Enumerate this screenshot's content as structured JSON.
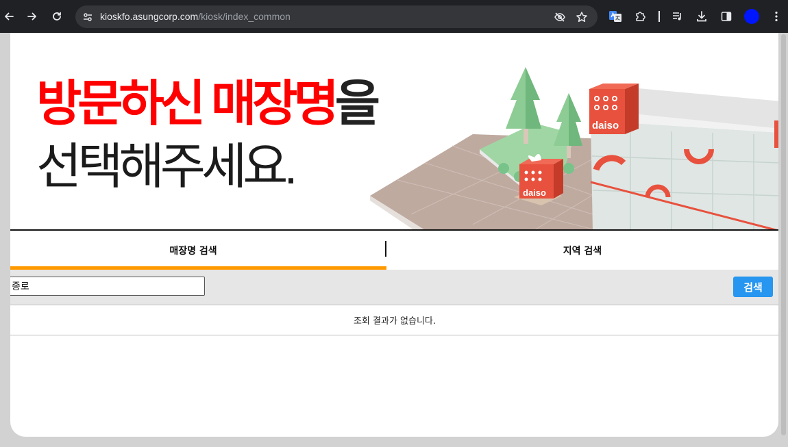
{
  "browser": {
    "url_host": "kioskfo.asungcorp.com",
    "url_path": "/kiosk/index_common",
    "icons": [
      "back-icon",
      "forward-icon",
      "reload-icon",
      "site-info-icon",
      "eye-off-icon",
      "star-icon",
      "translate-icon",
      "extensions-icon",
      "media-queue-icon",
      "download-icon",
      "side-panel-icon",
      "profile-avatar",
      "more-menu-icon"
    ],
    "profile_color": "#0016ff"
  },
  "hero": {
    "title_red": "방문하신 매장명",
    "title_black": "을",
    "title_line2": "선택해주세요.",
    "title_red_color": "#ff0000",
    "store_logo": "daiso"
  },
  "tabs": [
    {
      "label": "매장명 검색",
      "active": true
    },
    {
      "label": "지역 검색",
      "active": false
    }
  ],
  "search": {
    "value": "종로",
    "button_label": "검색",
    "button_color": "#2696f0",
    "tab_accent_color": "#ff9900"
  },
  "results": {
    "empty_message": "조회 결과가 없습니다."
  }
}
